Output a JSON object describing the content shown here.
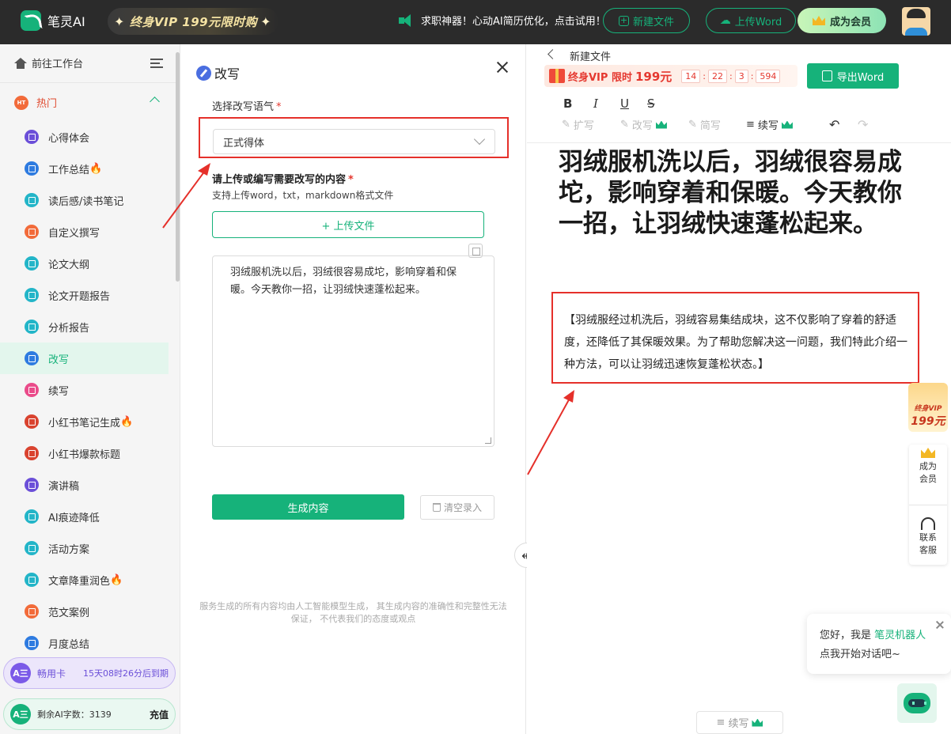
{
  "topbar": {
    "app_name": "笔灵AI",
    "vip_banner": "终身VIP 199元限时购",
    "notice": "求职神器！心动AI简历优化，点击试用！",
    "new_file": "新建文件",
    "upload_word": "上传Word",
    "become_member": "成为会员",
    "brand_color": "#16b27a"
  },
  "sidebar": {
    "workspace": "前往工作台",
    "hot_group": "热门",
    "hot_badge": "HT",
    "items": [
      {
        "label": "心得体会",
        "icon": "purple",
        "fire": false
      },
      {
        "label": "工作总结",
        "icon": "blue",
        "fire": true
      },
      {
        "label": "读后感/读书笔记",
        "icon": "cyan",
        "fire": false
      },
      {
        "label": "自定义撰写",
        "icon": "orange",
        "fire": false
      },
      {
        "label": "论文大纲",
        "icon": "cyan",
        "fire": false
      },
      {
        "label": "论文开题报告",
        "icon": "cyan",
        "fire": false
      },
      {
        "label": "分析报告",
        "icon": "cyan",
        "fire": false
      },
      {
        "label": "改写",
        "icon": "blue",
        "fire": false
      },
      {
        "label": "续写",
        "icon": "pink",
        "fire": false
      },
      {
        "label": "小红书笔记生成",
        "icon": "red",
        "fire": true
      },
      {
        "label": "小红书爆款标题",
        "icon": "red",
        "fire": false
      },
      {
        "label": "演讲稿",
        "icon": "purple",
        "fire": false
      },
      {
        "label": "AI痕迹降低",
        "icon": "cyan",
        "fire": false
      },
      {
        "label": "活动方案",
        "icon": "cyan",
        "fire": false
      },
      {
        "label": "文章降重润色",
        "icon": "cyan",
        "fire": true
      },
      {
        "label": "范文案例",
        "icon": "orange",
        "fire": false
      },
      {
        "label": "月度总结",
        "icon": "blue",
        "fire": false
      }
    ],
    "pass_card": {
      "logo": "A三",
      "name": "畅用卡",
      "expire": "15天08时26分后到期"
    },
    "words_card": {
      "logo": "A三",
      "label": "剩余AI字数：3139",
      "charge": "充值"
    }
  },
  "panel": {
    "title": "改写",
    "tone_label": "选择改写语气",
    "tone_value": "正式得体",
    "content_label": "请上传或编写需要改写的内容",
    "content_hint": "支持上传word，txt，markdown格式文件",
    "upload_btn": "+ 上传文件",
    "input_text": "羽绒服机洗以后，羽绒很容易成坨，影响穿着和保暖。今天教你一招，让羽绒快速蓬松起来。",
    "generate_btn": "生成内容",
    "clear_btn": "清空录入",
    "disclaimer": "服务生成的所有内容均由人工智能模型生成， 其生成内容的准确性和完整性无法保证， 不代表我们的态度或观点"
  },
  "editor": {
    "doc_name": "新建文件",
    "promo_text": "终身VIP 限时",
    "promo_price": "199元",
    "countdown": [
      "14",
      "22",
      "3",
      "594"
    ],
    "export_btn": "导出Word",
    "toolbar": {
      "bold": "B",
      "italic": "I",
      "underline": "U",
      "strike": "S",
      "expand": "扩写",
      "rewrite": "改写",
      "shorten": "简写",
      "continue": "续写"
    },
    "title": "羽绒服机洗以后，羽绒很容易成坨，影响穿着和保暖。今天教你一招，让羽绒快速蓬松起来。",
    "rewritten": "【羽绒服经过机洗后，羽绒容易集结成块，这不仅影响了穿着的舒适度，还降低了其保暖效果。为了帮助您解决这一问题，我们特此介绍一种方法，可以让羽绒迅速恢复蓬松状态。】"
  },
  "float": {
    "vip_line1": "终身VIP",
    "vip_line2": "199元",
    "member": "成为会员",
    "service": "联系客服",
    "chat_greeting": "您好，我是",
    "chat_bot_name": "笔灵机器人",
    "chat_prompt": "点我开始对话吧~",
    "continue_btn": "续写"
  }
}
